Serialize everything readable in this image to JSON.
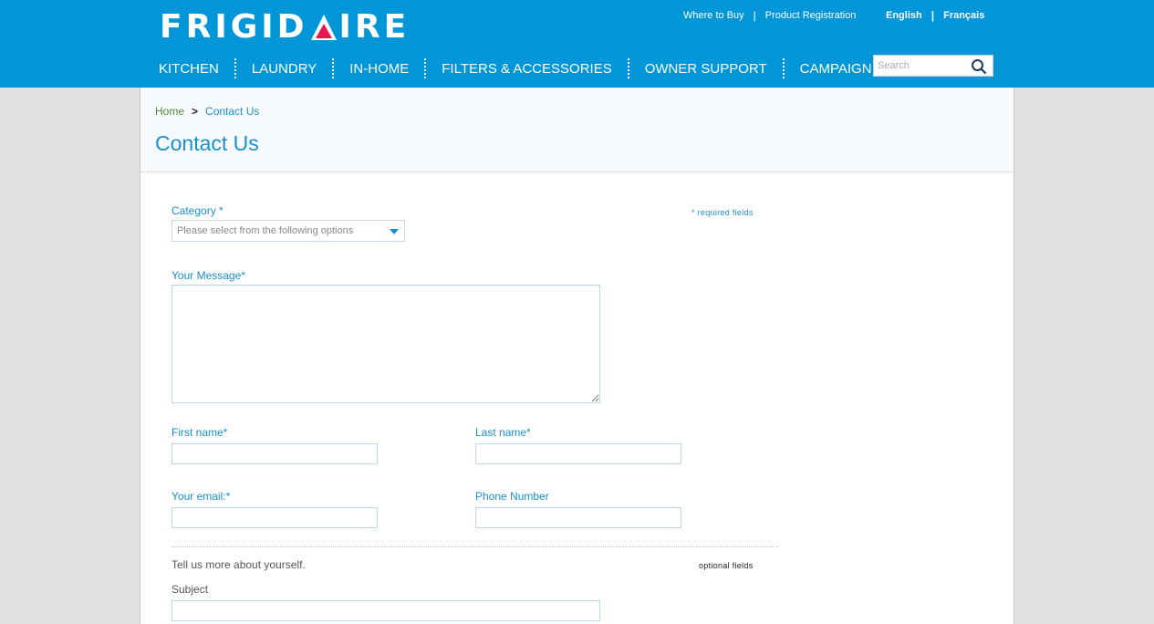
{
  "header": {
    "brand": {
      "left": "FRIGID",
      "right": "IRE",
      "accent_color": "#e8174f"
    },
    "util_links": [
      "Where to Buy",
      "Product Registration"
    ],
    "languages": [
      "English",
      "Français"
    ],
    "nav": [
      "KITCHEN",
      "LAUNDRY",
      "IN-HOME",
      "FILTERS & ACCESSORIES",
      "OWNER SUPPORT",
      "CAMPAIGN"
    ],
    "search": {
      "placeholder": "Search",
      "value": ""
    },
    "color": "#0096d8"
  },
  "breadcrumb": {
    "home": "Home",
    "separator": ">",
    "current": "Contact Us"
  },
  "page_title": "Contact Us",
  "form": {
    "required_note": "* required fields",
    "category": {
      "label": "Category *",
      "selected": "Please select from the following options"
    },
    "message": {
      "label": "Your Message*",
      "value": ""
    },
    "first_name": {
      "label": "First name*",
      "value": ""
    },
    "last_name": {
      "label": "Last name*",
      "value": ""
    },
    "email": {
      "label": "Your email:*",
      "value": ""
    },
    "phone": {
      "label": "Phone Number",
      "value": ""
    },
    "optional_intro": "Tell us more about yourself.",
    "optional_note": "optional fields",
    "subject": {
      "label": "Subject",
      "value": ""
    }
  }
}
